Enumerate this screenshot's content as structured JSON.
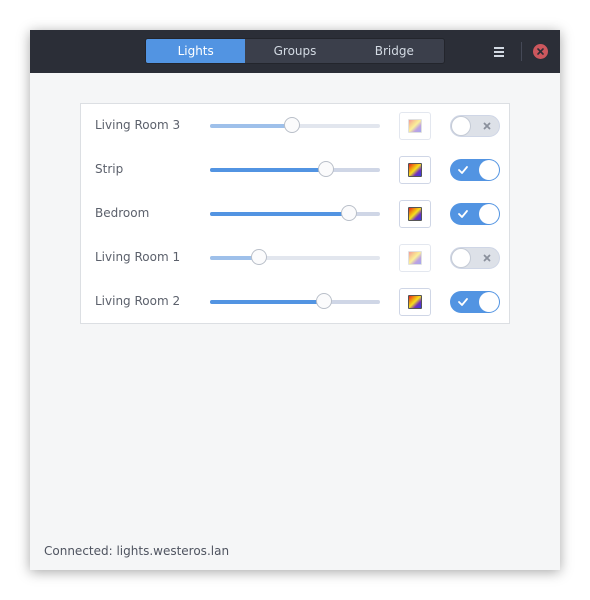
{
  "tabs": [
    {
      "label": "Lights",
      "active": true
    },
    {
      "label": "Groups",
      "active": false
    },
    {
      "label": "Bridge",
      "active": false
    }
  ],
  "header": {
    "menu_icon": "hamburger-menu-icon",
    "close_icon": "close-icon"
  },
  "lights": [
    {
      "name": "Living Room 3",
      "brightness": 0.48,
      "on": false
    },
    {
      "name": "Strip",
      "brightness": 0.68,
      "on": true
    },
    {
      "name": "Bedroom",
      "brightness": 0.82,
      "on": true
    },
    {
      "name": "Living Room 1",
      "brightness": 0.29,
      "on": false
    },
    {
      "name": "Living Room 2",
      "brightness": 0.67,
      "on": true
    }
  ],
  "status": {
    "text": "Connected: lights.westeros.lan"
  },
  "colors": {
    "accent": "#5294e2",
    "headerbar": "#2b2e37",
    "close": "#cc575d",
    "window_bg": "#f5f6f7"
  }
}
